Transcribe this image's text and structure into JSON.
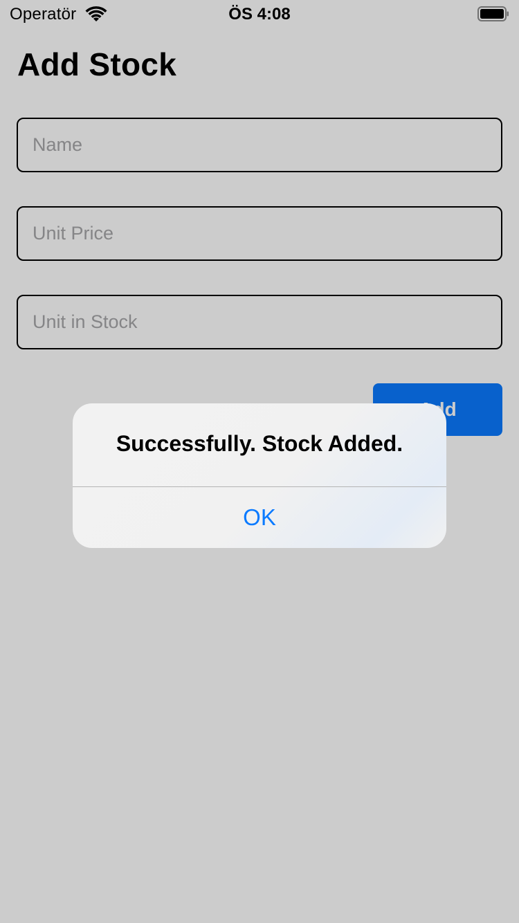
{
  "status_bar": {
    "carrier": "Operatör",
    "time": "ÖS 4:08",
    "wifi_icon": "wifi-icon",
    "battery_icon": "battery-full-icon"
  },
  "page": {
    "title": "Add Stock",
    "fields": {
      "name": {
        "placeholder": "Name",
        "value": ""
      },
      "unit_price": {
        "placeholder": "Unit Price",
        "value": ""
      },
      "unit_in_stock": {
        "placeholder": "Unit in Stock",
        "value": ""
      }
    },
    "add_button_label": "Add"
  },
  "alert": {
    "message": "Successfully. Stock Added.",
    "ok_label": "OK"
  },
  "colors": {
    "accent": "#0a7aff",
    "background": "#ffffff",
    "overlay": "rgba(0,0,0,0.2)",
    "placeholder": "#a7a7a9"
  }
}
